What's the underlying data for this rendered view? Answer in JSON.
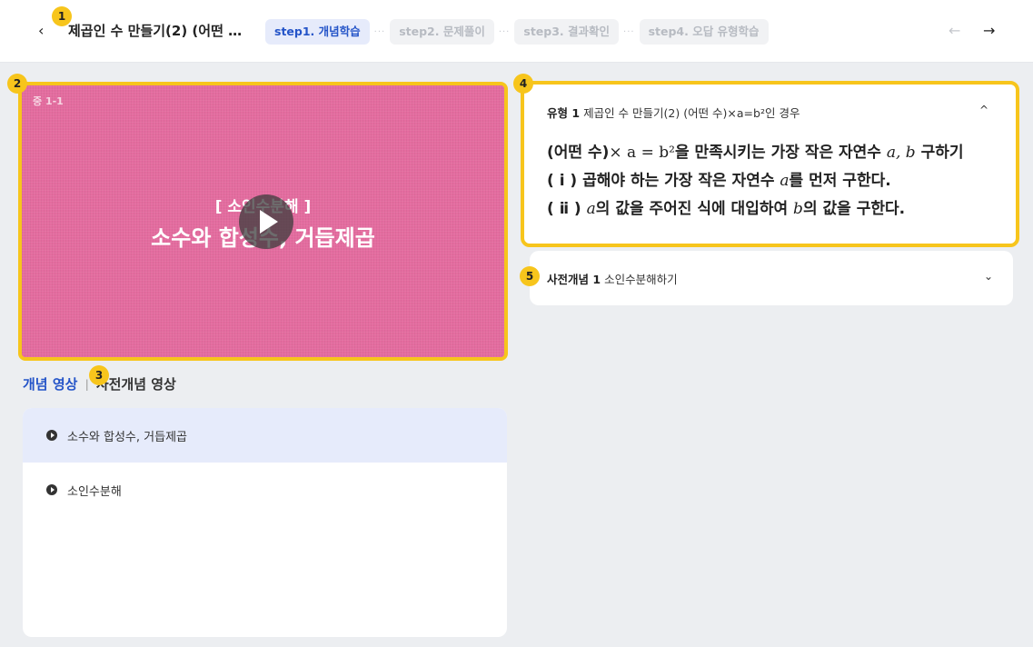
{
  "header": {
    "title": "제곱인 수 만들기(2) (어떤 …",
    "back_icon": "‹",
    "steps": [
      "step1. 개념학습",
      "step2. 문제풀이",
      "step3. 결과확인",
      "step4. 오답 유형학습"
    ],
    "step_separator": "···",
    "prev_icon": "←",
    "next_icon": "→"
  },
  "badges": [
    "1",
    "2",
    "3",
    "4",
    "5"
  ],
  "video": {
    "code": "중 1-1",
    "subtitle": "[ 소인수분해 ]",
    "title": "소수와 합성수, 거듭제곱"
  },
  "tabs": {
    "active": "개념 영상",
    "separator": "|",
    "inactive": "사전개념 영상"
  },
  "video_list": [
    {
      "label": "소수와 합성수, 거듭제곱",
      "selected": true
    },
    {
      "label": "소인수분해",
      "selected": false
    }
  ],
  "concept_card": {
    "type_label": "유형 1",
    "type_title": "제곱인 수 만들기(2) (어떤 수)×a=b²인 경우",
    "collapse_icon": "^",
    "line1_a": "(어떤 수)",
    "line1_math": "× a = b²",
    "line1_b": "을 만족시키는 가장 작은 자연수",
    "line1_math2": "a, b",
    "line1_c": "구하기",
    "line2_a": "( ⅰ ) 곱해야 하는 가장 작은 자연수",
    "line2_math": "a",
    "line2_b": "를 먼저 구한다.",
    "line3_a": "( ⅱ )",
    "line3_math": "a",
    "line3_b": "의 값을 주어진 식에 대입하여",
    "line3_math2": "b",
    "line3_c": "의 값을 구한다."
  },
  "prereq_card": {
    "label": "사전개념 1",
    "title": "소인수분해하기",
    "expand_icon": "⌄"
  },
  "colors": {
    "accent": "#2454c8",
    "highlight": "#f7c51c",
    "video_bg": "#e46c9f"
  }
}
